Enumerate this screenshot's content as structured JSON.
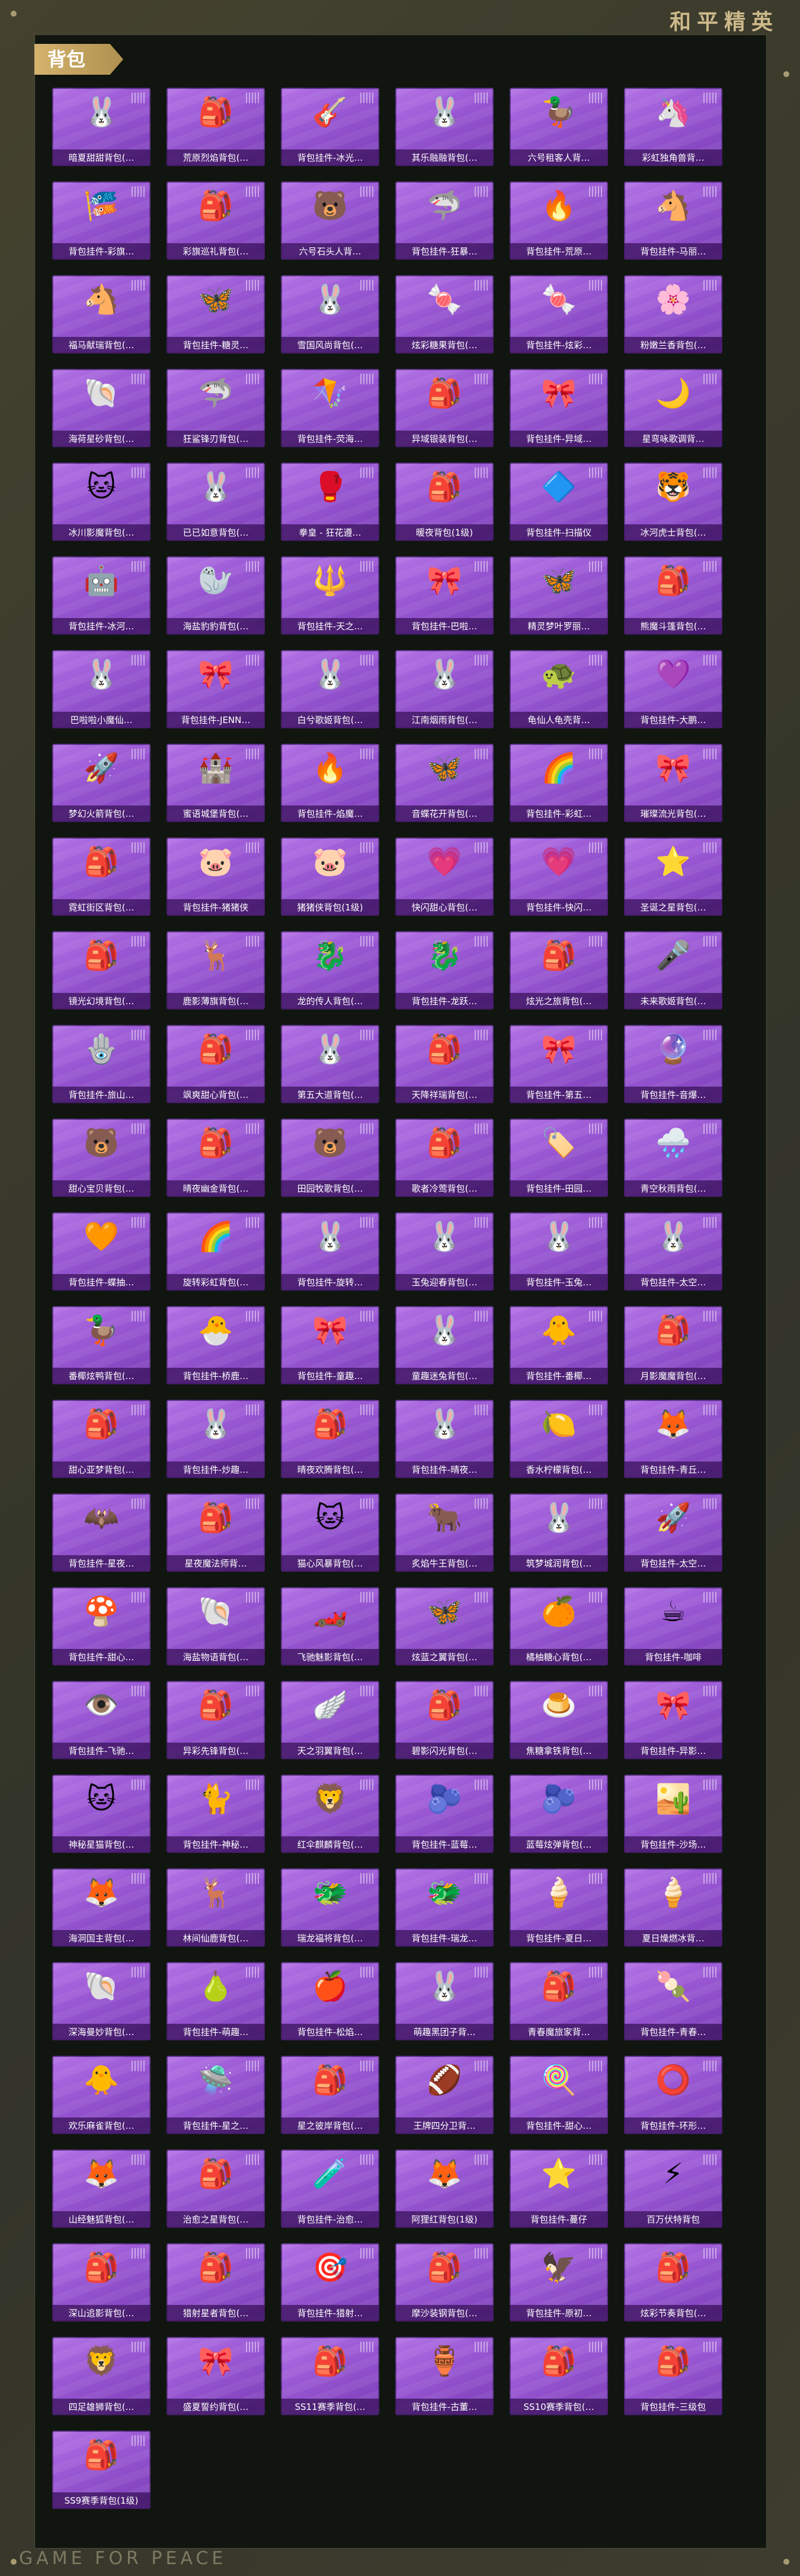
{
  "brand": "和平精英",
  "footer_brand": "GAME FOR PEACE",
  "tab": {
    "label": "背包"
  },
  "items": [
    "暗夏甜甜背包(…",
    "荒原烈焰背包(…",
    "背包挂件-冰光…",
    "其乐融融背包(…",
    "六号租客人背…",
    "彩虹独角兽背…",
    "背包挂件-彩旗…",
    "彩旗巡礼背包(…",
    "六号石头人背…",
    "背包挂件-狂暴…",
    "背包挂件-荒原…",
    "背包挂件-马丽…",
    "福马献瑞背包(…",
    "背包挂件-糖灵…",
    "雪国风尚背包(…",
    "炫彩糖果背包(…",
    "背包挂件-炫彩…",
    "粉嫩兰香背包(…",
    "海荷星砂背包(…",
    "狂鲨锋刃背包(…",
    "背包挂件-荧海…",
    "异域银装背包(…",
    "背包挂件-异域…",
    "星弯咏歌调背…",
    "冰川影魔背包(…",
    "已已如意背包(…",
    "拳皇 - 狂花遵…",
    "暖夜背包(1级)",
    "背包挂件-扫描仪",
    "冰河虎士背包(…",
    "背包挂件-冰河…",
    "海盐豹豹背包(…",
    "背包挂件-天之…",
    "背包挂件-巴啦…",
    "精灵梦叶罗丽…",
    "熊魔斗篷背包(…",
    "巴啦啦小魔仙…",
    "背包挂件-JENN…",
    "白兮歌姬背包(…",
    "江南烟雨背包(…",
    "龟仙人龟壳背…",
    "背包挂件-大鹏…",
    "梦幻火箭背包(…",
    "蜜语城堡背包(…",
    "背包挂件-焰魔…",
    "音蝶花开背包(…",
    "背包挂件-彩虹…",
    "璀璨流光背包(…",
    "霓虹街区背包(…",
    "背包挂件-猪猪侠",
    "猪猪侠背包(1级)",
    "快闪甜心背包(…",
    "背包挂件-快闪…",
    "圣诞之星背包(…",
    "镜光幻境背包(…",
    "鹿影薄旗背包(…",
    "龙的传人背包(…",
    "背包挂件-龙跃…",
    "炫光之旅背包(…",
    "未来歌姬背包(…",
    "背包挂件-旅山…",
    "飒爽甜心背包(…",
    "第五大道背包(…",
    "天降祥瑞背包(…",
    "背包挂件-第五…",
    "背包挂件-音爆…",
    "甜心宝贝背包(…",
    "晴夜幽金背包(…",
    "田园牧歌背包(…",
    "歌者冷莺背包(…",
    "背包挂件-田园…",
    "青空秋雨背包(…",
    "背包挂件-蝶抽…",
    "旋转彩虹背包(…",
    "背包挂件-旋转…",
    "玉兔迎春背包(…",
    "背包挂件-玉兔…",
    "背包挂件-太空…",
    "番椰炫鸭背包(…",
    "背包挂件-桥鹿…",
    "背包挂件-童趣…",
    "童趣迷兔背包(…",
    "背包挂件-番椰…",
    "月影魔魔背包(…",
    "甜心亚梦背包(…",
    "背包挂件-炒趣…",
    "晴夜欢腾背包(…",
    "背包挂件-晴夜…",
    "香水柠檬背包(…",
    "背包挂件-青丘…",
    "背包挂件-星夜…",
    "星夜魔法师背…",
    "猫心风暴背包(…",
    "炙焰牛王背包(…",
    "筑梦城润背包(…",
    "背包挂件-太空…",
    "背包挂件-甜心…",
    "海盐物语背包(…",
    "飞驰魅影背包(…",
    "炫蓝之翼背包(…",
    "橘柚糖心背包(…",
    "背包挂件-咖啡",
    "背包挂件-飞驰…",
    "异彩先锋背包(…",
    "天之羽翼背包(…",
    "碧影闪光背包(…",
    "焦糖拿铁背包(…",
    "背包挂件-异影…",
    "神秘星猫背包(…",
    "背包挂件-神秘…",
    "红伞麒麟背包(…",
    "背包挂件-蓝莓…",
    "蓝莓炫弹背包(…",
    "背包挂件-沙场…",
    "海洞国主背包(…",
    "林间仙鹿背包(…",
    "瑞龙福将背包(…",
    "背包挂件-瑞龙…",
    "背包挂件-夏日…",
    "夏日燥燃冰背…",
    "深海曼妙背包(…",
    "背包挂件-萌趣…",
    "背包挂件-松焰…",
    "萌趣黑团子背…",
    "青春魔旅家背…",
    "背包挂件-青春…",
    "欢乐麻雀背包(…",
    "背包挂件-星之…",
    "星之彼岸背包(…",
    "王牌四分卫背…",
    "背包挂件-甜心…",
    "背包挂件-环形…",
    "山经魅狐背包(…",
    "治愈之星背包(…",
    "背包挂件-治愈…",
    "阿狸红背包(1级)",
    "背包挂件-蔓仔",
    "百万伏特背包",
    "深山追影背包(…",
    "猎射星者背包(…",
    "背包挂件-猎射…",
    "摩沙装钢背包(…",
    "背包挂件-原初…",
    "炫彩节奏背包(…",
    "四足雄狮背包(…",
    "盛夏誓约背包(…",
    "SS11赛季背包(…",
    "背包挂件-古董…",
    "SS10赛季背包(…",
    "背包挂件-三级包",
    "SS9赛季背包(1级)"
  ],
  "icons": [
    "🐰",
    "🎒",
    "🎸",
    "🐰",
    "🦆",
    "🦄",
    "🎏",
    "🎒",
    "🐻",
    "🦈",
    "🔥",
    "🐴",
    "🐴",
    "🦋",
    "🐰",
    "🍬",
    "🍬",
    "🌸",
    "🐚",
    "🦈",
    "🪁",
    "🎒",
    "🎀",
    "🌙",
    "🐱",
    "🐰",
    "🥊",
    "🎒",
    "🔷",
    "🐯",
    "🤖",
    "🦭",
    "🔱",
    "🎀",
    "🦋",
    "🎒",
    "🐰",
    "🎀",
    "🐰",
    "🐰",
    "🐢",
    "💜",
    "🚀",
    "🏰",
    "🔥",
    "🦋",
    "🌈",
    "🎀",
    "🎒",
    "🐷",
    "🐷",
    "💗",
    "💗",
    "⭐",
    "🎒",
    "🦌",
    "🐉",
    "🐉",
    "🎒",
    "🎤",
    "🪬",
    "🎒",
    "🐰",
    "🎒",
    "🎀",
    "🔮",
    "🐻",
    "🎒",
    "🐻",
    "🎒",
    "🏷️",
    "🌧️",
    "🧡",
    "🌈",
    "🐰",
    "🐰",
    "🐰",
    "🐰",
    "🦆",
    "🐣",
    "🎀",
    "🐰",
    "🐥",
    "🎒",
    "🎒",
    "🐰",
    "🎒",
    "🐰",
    "🍋",
    "🦊",
    "🦇",
    "🎒",
    "🐱",
    "🐂",
    "🐰",
    "🚀",
    "🍄",
    "🐚",
    "🏎️",
    "🦋",
    "🍊",
    "☕",
    "👁️",
    "🎒",
    "🪽",
    "🎒",
    "🍮",
    "🎀",
    "🐱",
    "🐈",
    "🦁",
    "🫐",
    "🫐",
    "🏜️",
    "🦊",
    "🦌",
    "🐲",
    "🐲",
    "🍦",
    "🍦",
    "🐚",
    "🍐",
    "🍎",
    "🐰",
    "🎒",
    "🍡",
    "🐥",
    "🛸",
    "🎒",
    "🏈",
    "🍭",
    "⭕",
    "🦊",
    "🎒",
    "🧪",
    "🦊",
    "⭐",
    "⚡",
    "🎒",
    "🎒",
    "🎯",
    "🎒",
    "🦅",
    "🎒",
    "🦁",
    "🎀",
    "🎒",
    "🏺",
    "🎒",
    "🎒",
    "🎒"
  ],
  "colors": {
    "panel_bg": "#10150f",
    "tab": "#d3b36d",
    "card": "#9a58d4",
    "brand": "#cdb98a"
  }
}
